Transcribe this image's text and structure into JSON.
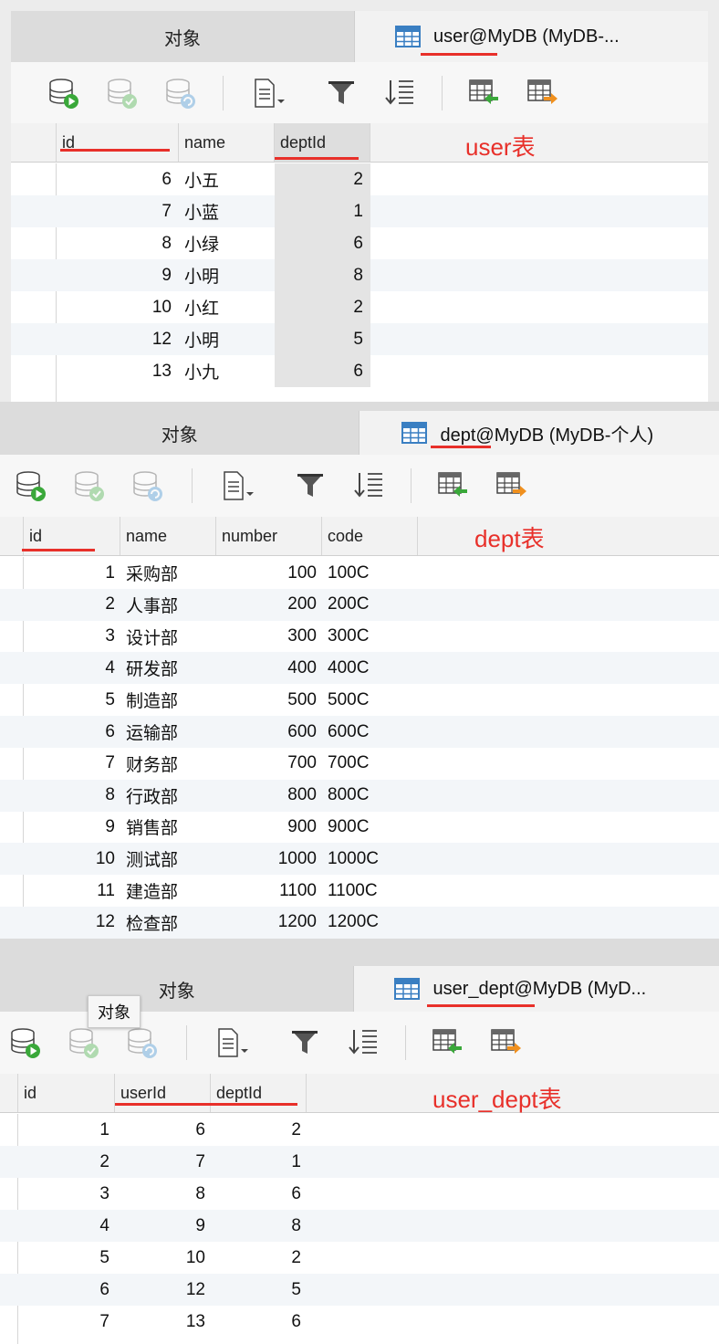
{
  "tabs": {
    "objects_label": "对象"
  },
  "tooltip": "对象",
  "panels": [
    {
      "tab_title": "user@MyDB (MyDB-...",
      "annotation": "user表",
      "columns": [
        "id",
        "name",
        "deptId"
      ],
      "rows": [
        [
          "6",
          "小五",
          "2"
        ],
        [
          "7",
          "小蓝",
          "1"
        ],
        [
          "8",
          "小绿",
          "6"
        ],
        [
          "9",
          "小明",
          "8"
        ],
        [
          "10",
          "小红",
          "2"
        ],
        [
          "12",
          "小明",
          "5"
        ],
        [
          "13",
          "小九",
          "6"
        ]
      ]
    },
    {
      "tab_title": "dept@MyDB (MyDB-个人)",
      "annotation": "dept表",
      "columns": [
        "id",
        "name",
        "number",
        "code"
      ],
      "rows": [
        [
          "1",
          "采购部",
          "100",
          "100C"
        ],
        [
          "2",
          "人事部",
          "200",
          "200C"
        ],
        [
          "3",
          "设计部",
          "300",
          "300C"
        ],
        [
          "4",
          "研发部",
          "400",
          "400C"
        ],
        [
          "5",
          "制造部",
          "500",
          "500C"
        ],
        [
          "6",
          "运输部",
          "600",
          "600C"
        ],
        [
          "7",
          "财务部",
          "700",
          "700C"
        ],
        [
          "8",
          "行政部",
          "800",
          "800C"
        ],
        [
          "9",
          "销售部",
          "900",
          "900C"
        ],
        [
          "10",
          "测试部",
          "1000",
          "1000C"
        ],
        [
          "11",
          "建造部",
          "1100",
          "1100C"
        ],
        [
          "12",
          "检查部",
          "1200",
          "1200C"
        ]
      ]
    },
    {
      "tab_title": "user_dept@MyDB (MyD...",
      "annotation": "user_dept表",
      "columns": [
        "id",
        "userId",
        "deptId"
      ],
      "rows": [
        [
          "1",
          "6",
          "2"
        ],
        [
          "2",
          "7",
          "1"
        ],
        [
          "3",
          "8",
          "6"
        ],
        [
          "4",
          "9",
          "8"
        ],
        [
          "5",
          "10",
          "2"
        ],
        [
          "6",
          "12",
          "5"
        ],
        [
          "7",
          "13",
          "6"
        ]
      ]
    }
  ],
  "colors": {
    "accent_red": "#e8302a",
    "table_icon_blue": "#3a7fc2",
    "run_green": "#3aa83a"
  },
  "toolbar_icons": [
    "db-run-icon",
    "db-commit-icon",
    "db-refresh-icon",
    "document-icon",
    "filter-icon",
    "sort-icon",
    "import-table-icon",
    "export-table-icon"
  ]
}
